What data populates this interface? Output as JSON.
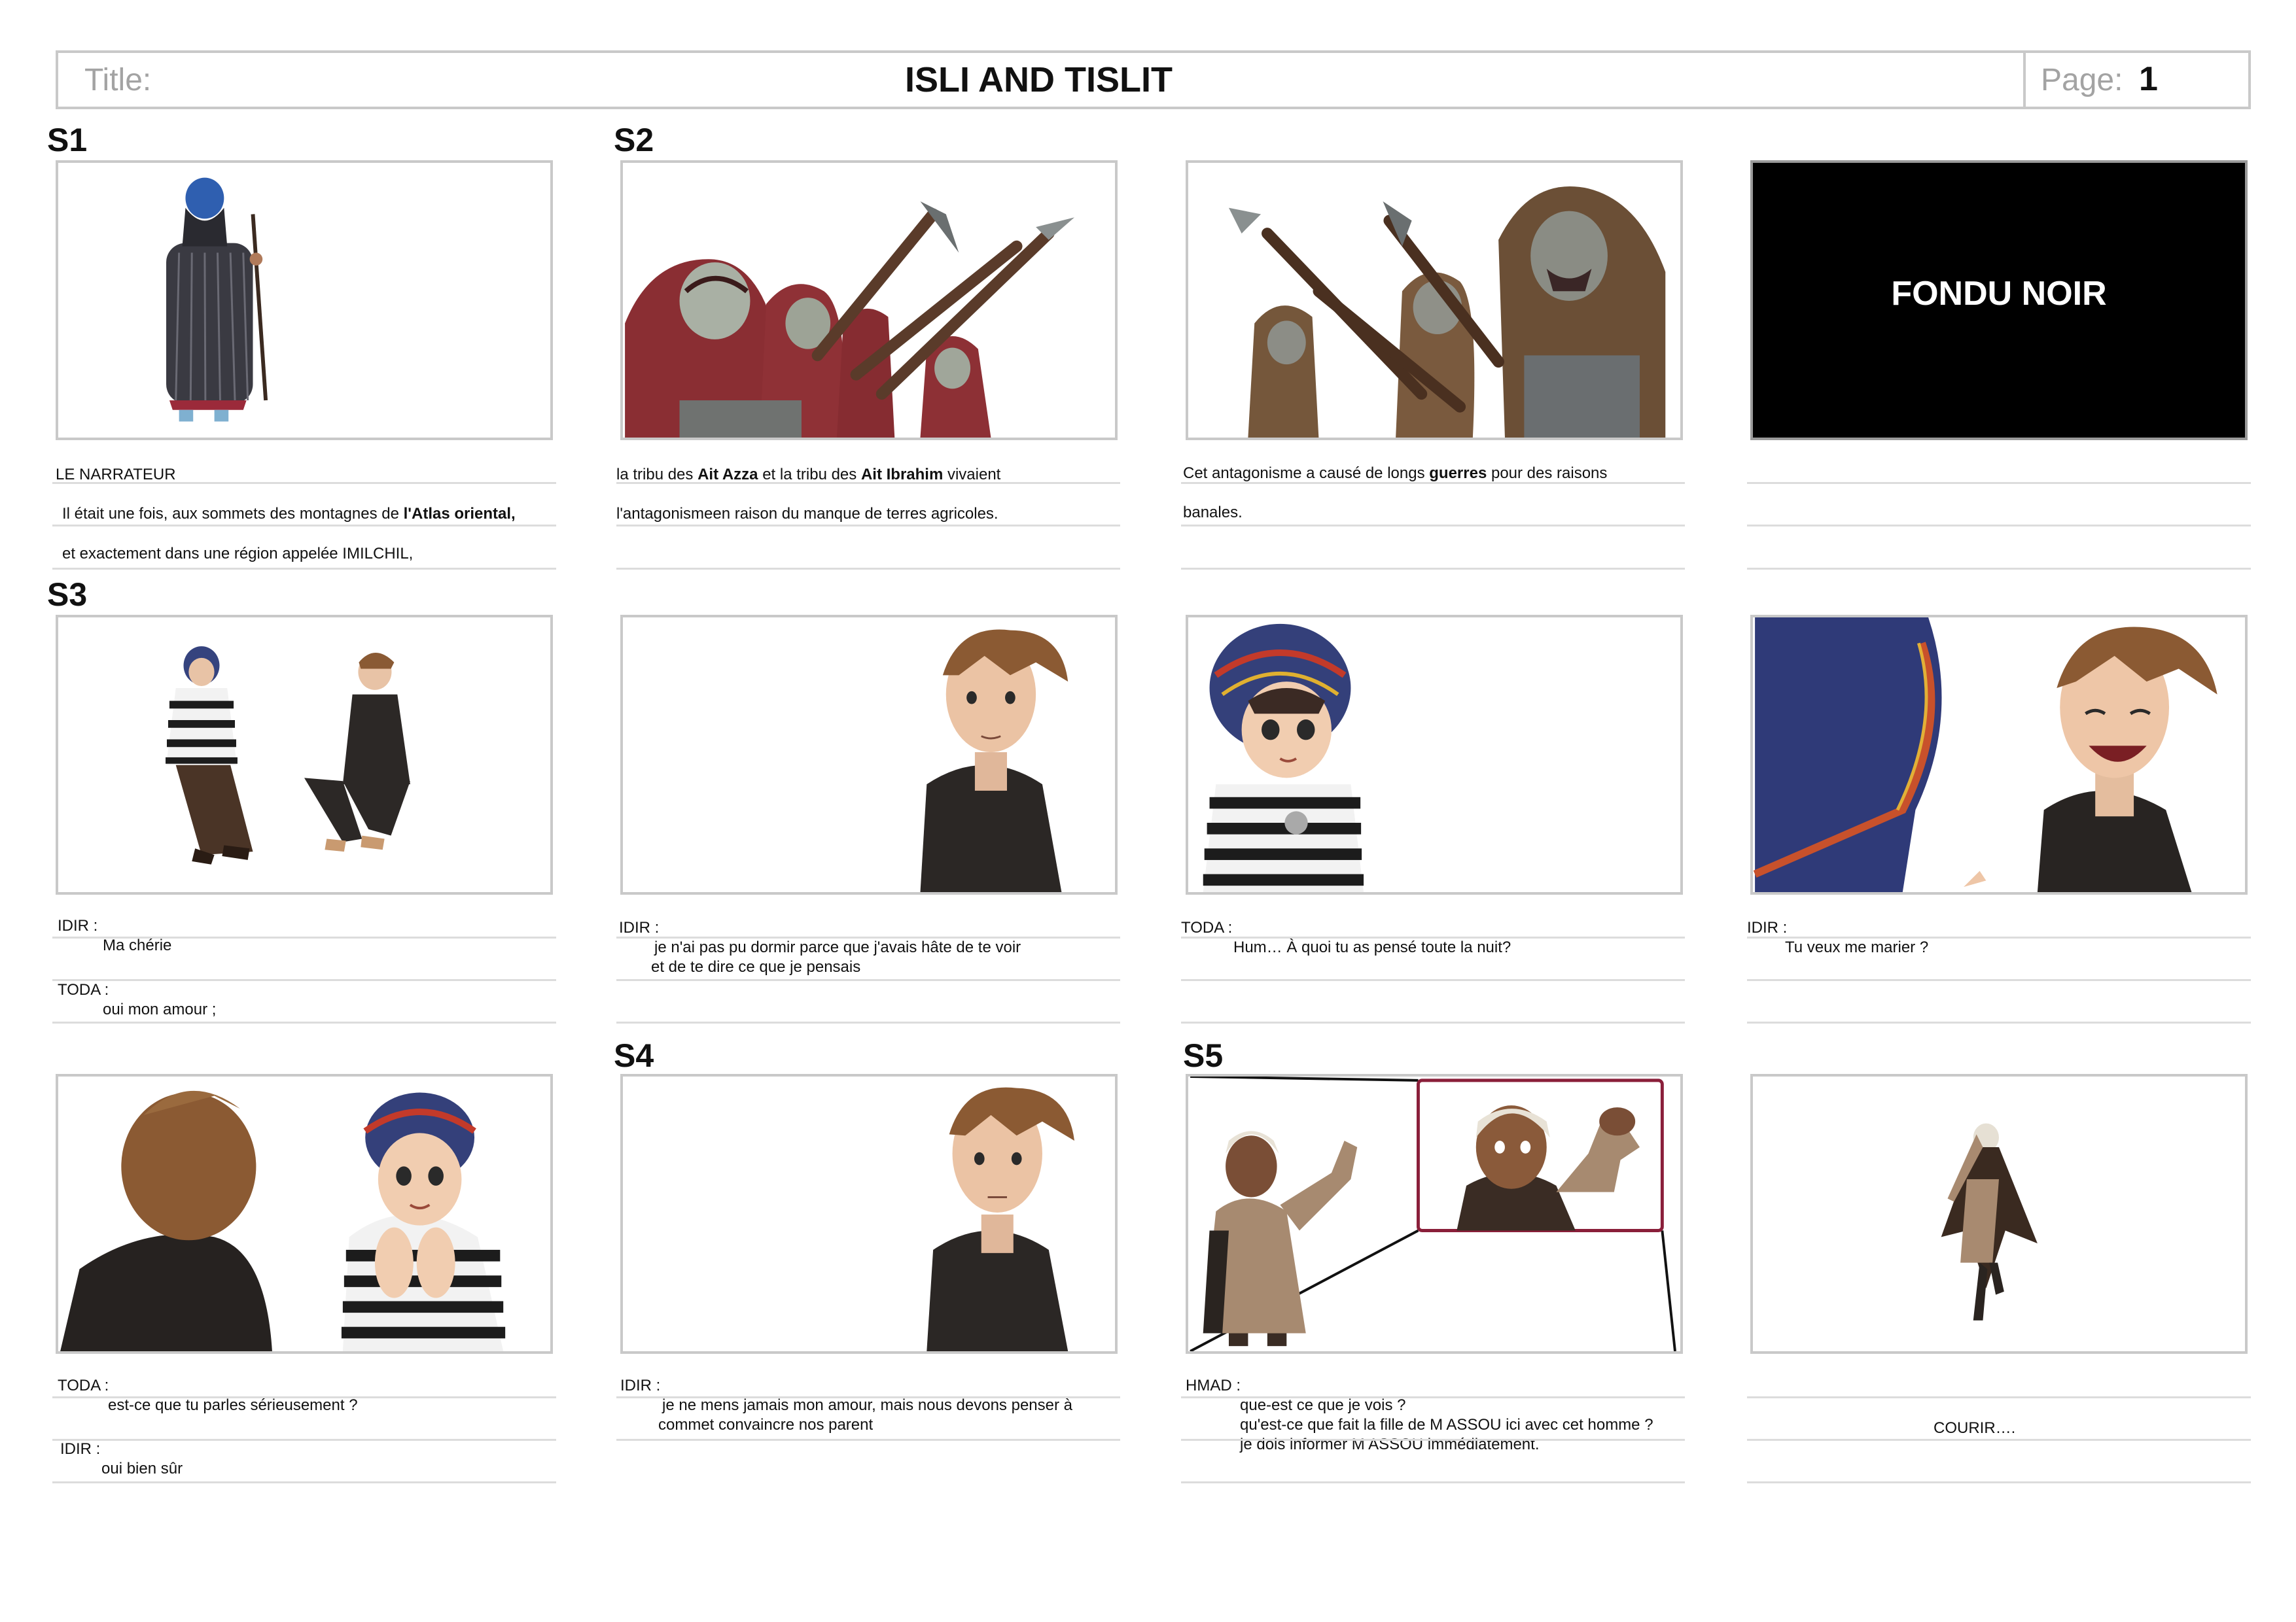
{
  "header": {
    "title_label": "Title:",
    "title": "ISLI AND TISLIT",
    "page_label": "Page:",
    "page_number": "1"
  },
  "scenes": {
    "s1": "S1",
    "s2": "S2",
    "s3": "S3",
    "s4": "S4",
    "s5": "S5"
  },
  "panels": {
    "p4_text": "FONDU NOIR"
  },
  "captions": {
    "narrator_name": "LE NARRATEUR",
    "narrator_l1_a": "Il était une fois, aux sommets des montagnes de ",
    "narrator_l1_b": "l'Atlas oriental",
    "narrator_l1_c": ",",
    "narrator_l2": "et exactement dans une région appelée IMILCHIL,",
    "p2_l1_a": "la tribu des ",
    "p2_l1_b": "Ait Azza",
    "p2_l1_c": " et la tribu des ",
    "p2_l1_d": "Ait Ibrahim",
    "p2_l1_e": " vivaient",
    "p2_l2": "l'antagonismeen raison du manque de terres agricoles.",
    "p3_l1_a": "Cet antagonisme a causé de longs ",
    "p3_l1_b": "guerres",
    "p3_l1_c": " pour des raisons",
    "p3_l2": "banales.",
    "p5_sp1": "IDIR   :",
    "p5_l1": "Ma chérie",
    "p5_sp2": "TODA :",
    "p5_l2": "oui mon amour ;",
    "p6_sp": "IDIR :",
    "p6_l1": "je n'ai pas pu dormir parce que j'avais hâte de te voir",
    "p6_l2": "et de te dire ce que je pensais",
    "p7_sp": "TODA :",
    "p7_l1": "Hum…  À quoi tu as pensé toute la nuit?",
    "p8_sp": "IDIR :",
    "p8_l1": "Tu veux me marier ?",
    "p9_sp1": "TODA :",
    "p9_l1": "est-ce que tu parles sérieusement ?",
    "p9_sp2": "IDIR :",
    "p9_l2": "oui bien sûr",
    "p10_sp": "IDIR :",
    "p10_l1": "je ne mens jamais mon amour, mais nous devons penser à",
    "p10_l2": "commet convaincre nos parent",
    "p11_sp": "HMAD :",
    "p11_l1": "que-est ce que je vois ?",
    "p11_l2": "qu'est-ce que fait la fille de M ASSOU ici avec cet homme ?",
    "p11_l3": "je dois informer M ASSOU immédiatement.",
    "p12_l1": "COURIR…."
  }
}
